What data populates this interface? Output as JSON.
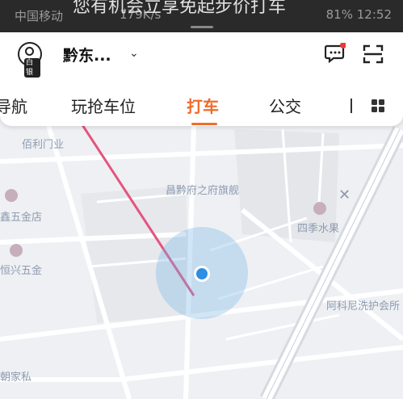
{
  "status_bar": {
    "carrier": "中国移动",
    "net_speed": "179K/s",
    "battery": "81%",
    "time": "12:52",
    "banner": "您有机会立享免起步价打车"
  },
  "header": {
    "avatar_tag": "白银",
    "city": "黔东...",
    "chevron": "⌄"
  },
  "tabs": [
    {
      "label": "导航"
    },
    {
      "label": "玩抢车位"
    },
    {
      "label": "打车",
      "active": true
    },
    {
      "label": "公交"
    }
  ],
  "map": {
    "pois": [
      {
        "label": "佰利门业"
      },
      {
        "label": "鑫五金店"
      },
      {
        "label": "恒兴五金"
      },
      {
        "label": "朝家私"
      },
      {
        "label": "四季水果"
      },
      {
        "label": "阿科尼洗护会所"
      },
      {
        "label": "昌黔府之府旗舰"
      }
    ]
  },
  "colors": {
    "accent": "#f26b2a",
    "location": "#2e8ee6"
  }
}
